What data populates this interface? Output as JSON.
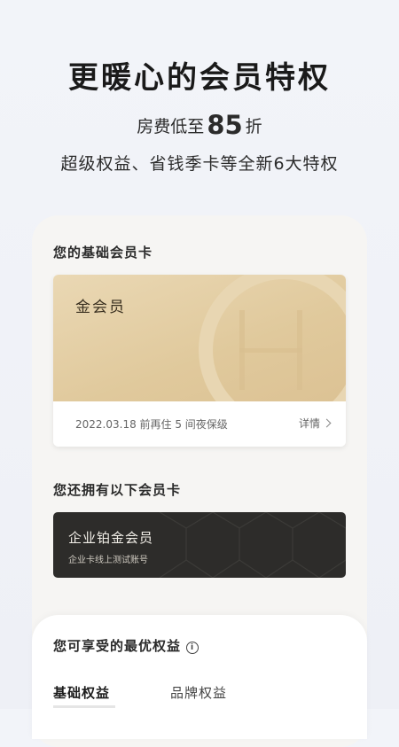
{
  "hero": {
    "title": "更暖心的会员特权",
    "discount_prefix": "房费低至",
    "discount_value": "85",
    "discount_suffix": "折",
    "features": "超级权益、省钱季卡等全新6大特权"
  },
  "basic_card_section": {
    "label": "您的基础会员卡",
    "card": {
      "name": "金会员",
      "emblem_letter": "H",
      "note": "2022.03.18 前再住 5 间夜保级",
      "detail_label": "详情"
    }
  },
  "other_cards_section": {
    "label": "您还拥有以下会员卡",
    "cards": [
      {
        "name": "企业铂金会员",
        "subtitle": "企业卡线上测试账号"
      }
    ]
  },
  "benefits_section": {
    "label": "您可享受的最优权益",
    "tabs": [
      {
        "label": "基础权益",
        "active": true
      },
      {
        "label": "品牌权益",
        "active": false
      }
    ]
  },
  "colors": {
    "gold_card": "#e0c99c",
    "dark_card": "#2d2c2a",
    "page_bg": "#f2f4f9"
  }
}
